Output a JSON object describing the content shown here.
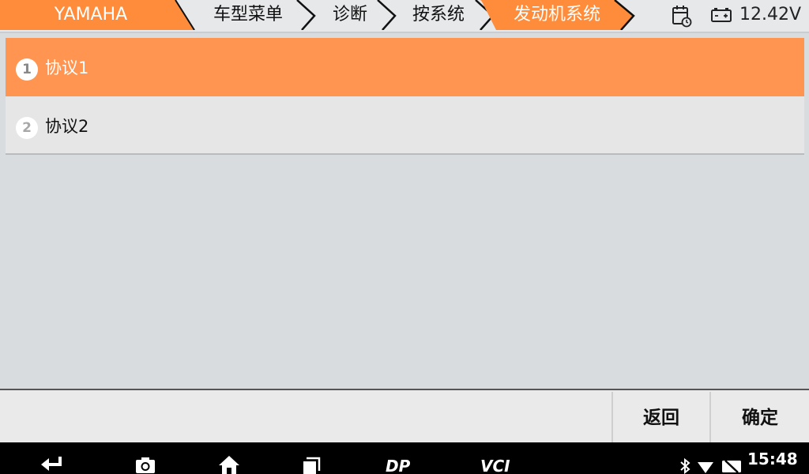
{
  "breadcrumb": {
    "items": [
      {
        "label": "YAMAHA",
        "active": true
      },
      {
        "label": "车型菜单",
        "active": false
      },
      {
        "label": "诊断",
        "active": false
      },
      {
        "label": "按系统",
        "active": false
      },
      {
        "label": "发动机系统",
        "active": true
      }
    ]
  },
  "status": {
    "voltage": "12.42V",
    "time": "15:48"
  },
  "list": {
    "items": [
      {
        "number": "1",
        "label": "协议1",
        "selected": true
      },
      {
        "number": "2",
        "label": "协议2",
        "selected": false
      }
    ]
  },
  "buttons": {
    "back_label": "返回",
    "confirm_label": "确定"
  },
  "navbar": {
    "dp_label": "DP",
    "vci_label": "VCI"
  },
  "colors": {
    "accent": "#ff9550",
    "breadcrumb_active": "#ff8c3a",
    "background": "#d9dcdf"
  }
}
